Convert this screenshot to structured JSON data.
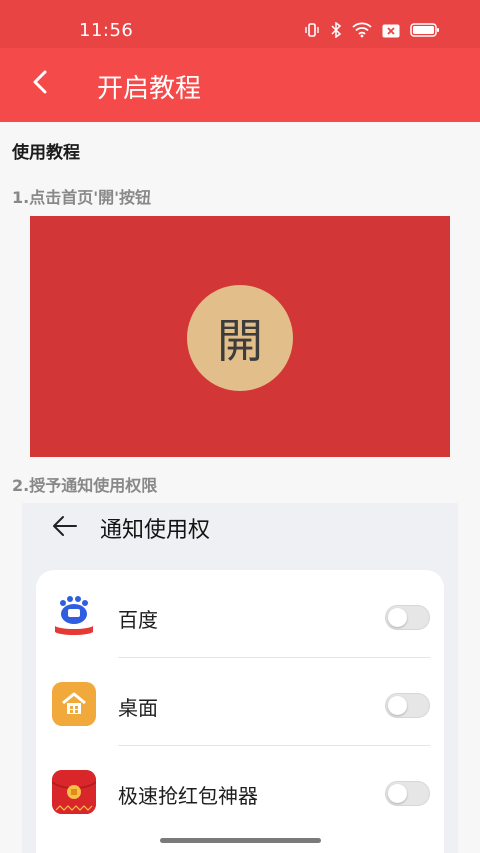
{
  "status_bar": {
    "time": "11:56"
  },
  "header": {
    "title": "开启教程"
  },
  "content": {
    "section_title": "使用教程",
    "step1_label": "1.点击首页'開'按钮",
    "open_button_char": "開",
    "step2_label": "2.授予通知使用权限"
  },
  "notification_screen": {
    "title": "通知使用权",
    "apps": [
      {
        "name": "百度",
        "icon": "baidu-app-icon",
        "enabled": false
      },
      {
        "name": "桌面",
        "icon": "home-desktop-app-icon",
        "enabled": false
      },
      {
        "name": "极速抢红包神器",
        "icon": "red-envelope-app-icon",
        "enabled": false
      }
    ]
  },
  "colors": {
    "status_bar": "#e84444",
    "app_bar": "#f44a4a",
    "red_card": "#d33636",
    "open_circle": "#e1be8a"
  }
}
